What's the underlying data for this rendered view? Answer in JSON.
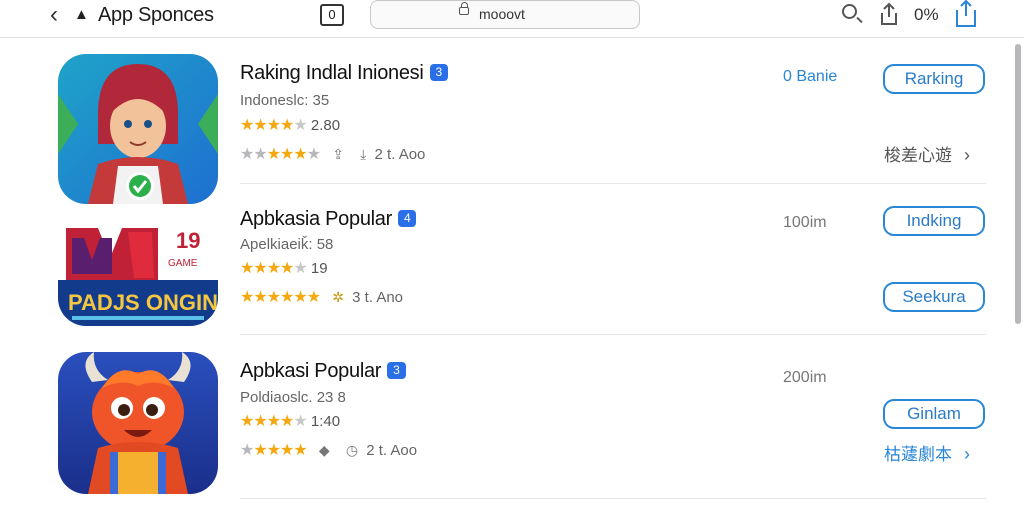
{
  "topbar": {
    "back_icon": "chevron-left-icon",
    "brand_icon": "app-store-icon",
    "title": "App Sponces",
    "tab_count": "0",
    "address": "mooovt",
    "zoom": "0%"
  },
  "apps": [
    {
      "name": "Raking Indlal Inionesi",
      "badge": "3",
      "sub": "Indoneslc:  35",
      "rating_stars": "★★★★",
      "rating_off": "★",
      "rating_value": "2.80",
      "meta_stars_grey": "★★",
      "meta_stars_gold": "★★★",
      "meta_stars_tail": "★",
      "meta_text": "2 t. Aoo",
      "right_label": "0 Banie",
      "action": "Rarking",
      "more": "梭差心遊"
    },
    {
      "name": "Apbkasia Popular",
      "badge": "4",
      "sub": "Apelkiaeiǩ:  58",
      "rating_stars": "★★★★",
      "rating_off": "★",
      "rating_value": "19",
      "meta_stars_grey": "★",
      "meta_stars_gold": "★★★★★",
      "meta_stars_tail": "",
      "meta_text": "3 t. Ano",
      "right_label": "100im",
      "action": "Indking",
      "action_2": "Seekura",
      "more": ""
    },
    {
      "name": "Apbkasi Popular",
      "badge": "3",
      "sub": "Poldiaoslc.  23  8",
      "rating_stars": "★★★★",
      "rating_off": "★",
      "rating_value": "1:40",
      "meta_stars_grey": "★",
      "meta_stars_gold": "★★★★",
      "meta_stars_tail": "",
      "meta_text": "2 t. Aoo",
      "right_label": "200im",
      "action": "Ginlam",
      "more": "枯蘧劇本"
    }
  ],
  "colors": {
    "accent": "#2a86d6",
    "badge": "#2a6ee8",
    "star": "#f3a90f"
  }
}
